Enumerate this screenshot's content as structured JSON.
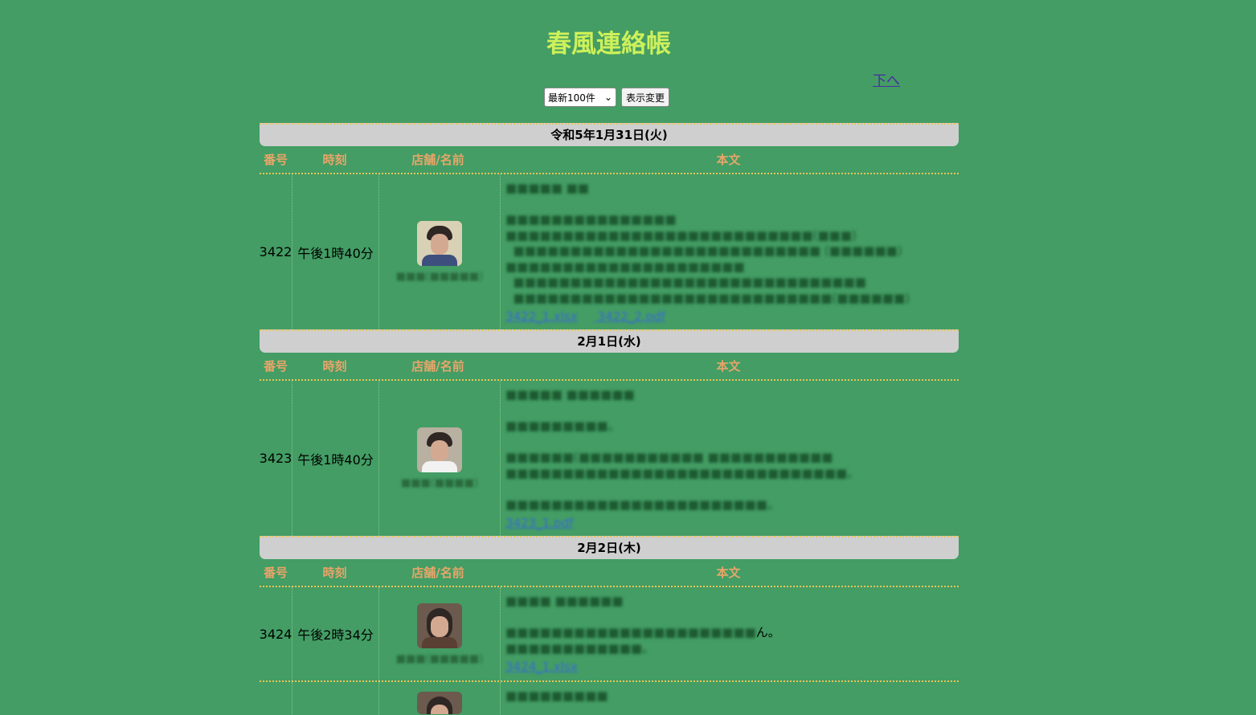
{
  "page": {
    "title": "春風連絡帳",
    "to_bottom_link": "下へ",
    "display_select": "最新100件",
    "change_display_button": "表示変更"
  },
  "columns": {
    "number": "番号",
    "time": "時刻",
    "store": "店舗/名前",
    "body": "本文"
  },
  "entries": [
    {
      "date": "令和5年1月31日(火)",
      "number": "3422",
      "time": "午後1時40分",
      "store_name": "■■■(■■■■■)",
      "body_lines": [
        "■■■■■ ■■",
        "",
        "■■■■■■■■■■■■■■■",
        "■■■■■■■■■■■■■■■■■■■■■■■■■■■(■■■)",
        "  ■■■■■■■■■■■■■■■■■■■■■■■■■■■ (■■■■■■)",
        "■■■■■■■■■■■■■■■■■■■■■",
        "  ■■■■■■■■■■■■■■■■■■■■■■■■■■■■■■■",
        "  ■■■■■■■■■■■■■■■■■■■■■■■■■■■■(■■■■■■)"
      ],
      "files": [
        "3422_1.xlsx",
        "3422_2.pdf"
      ]
    },
    {
      "date": "2月1日(水)",
      "number": "3423",
      "time": "午後1時40分",
      "store_name": "■■■(■■■■)",
      "body_lines": [
        "■■■■■ ■■■■■■",
        "",
        "■■■■■■■■■。",
        "",
        "■■■■■■(■■■■■■■■■■■ ■■■■■■■■■■■",
        "■■■■■■■■■■■■■■■■■■■■■■■■■■■■■■。",
        "",
        "■■■■■■■■■■■■■■■■■■■■■■■。"
      ],
      "files": [
        "3423_1.pdf"
      ]
    },
    {
      "date": "2月2日(木)",
      "number": "3424",
      "time": "午後2時34分",
      "store_name": "■■■(■■■■■)",
      "body_lines": [
        "■■■■ ■■■■■■",
        "",
        "■■■■■■■■■■■■■■■■■■■■■■",
        "■■■■■■■■■■■■。"
      ],
      "body_clear_tail": "ん。",
      "files": [
        "3424_1.xlsx"
      ]
    },
    {
      "number": "",
      "time": "",
      "body_lines": [
        "■■■■■■■■■"
      ]
    }
  ],
  "colors": {
    "background": "#439d64",
    "title": "#cdf05a",
    "date_bar": "#cfcfcf",
    "column_header": "#e8a56a",
    "dotted_rule": "#e8c55a",
    "link": "#4b2e9f"
  },
  "icons": [
    "chevron-down-icon"
  ]
}
